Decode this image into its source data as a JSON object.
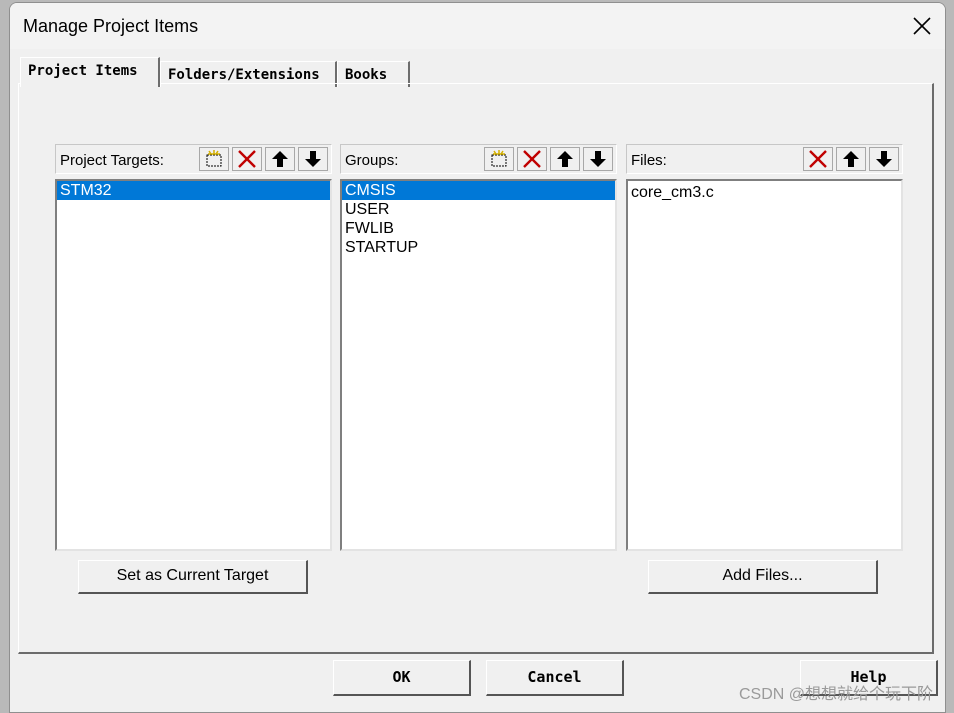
{
  "window": {
    "title": "Manage Project Items"
  },
  "tabs": [
    {
      "label": "Project Items",
      "active": true
    },
    {
      "label": "Folders/Extensions",
      "active": false
    },
    {
      "label": "Books",
      "active": false
    }
  ],
  "targets": {
    "label": "Project Targets:",
    "items": [
      {
        "label": "STM32",
        "selected": true
      }
    ],
    "button_label": "Set as Current Target"
  },
  "groups": {
    "label": "Groups:",
    "items": [
      {
        "label": "CMSIS",
        "selected": true
      },
      {
        "label": "USER",
        "selected": false
      },
      {
        "label": "FWLIB",
        "selected": false
      },
      {
        "label": "STARTUP",
        "selected": false
      }
    ]
  },
  "files": {
    "label": "Files:",
    "items": [
      {
        "label": "core_cm3.c",
        "selected": false
      }
    ],
    "button_label": "Add Files..."
  },
  "footer": {
    "ok_label": "OK",
    "cancel_label": "Cancel",
    "help_label": "Help"
  },
  "watermark": "CSDN @想想就给个玩下阶",
  "colors": {
    "selection": "#0078d7",
    "delete_icon": "#c00000"
  },
  "icons": [
    "close-icon",
    "new-item-icon",
    "delete-icon",
    "move-up-icon",
    "move-down-icon"
  ]
}
